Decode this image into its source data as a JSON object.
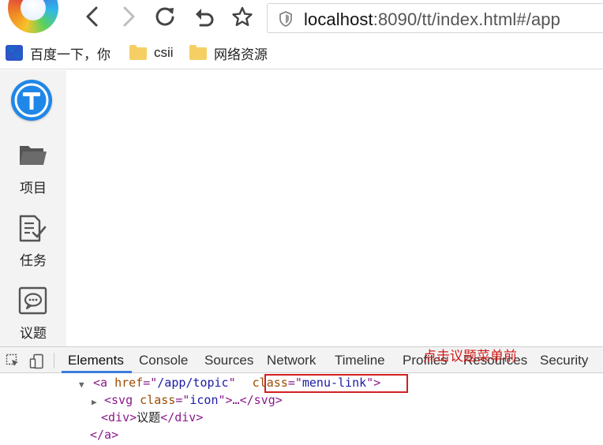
{
  "browser": {
    "url_host": "localhost",
    "url_rest": ":8090/tt/index.html#/app",
    "nav_icons": [
      "back-icon",
      "forward-icon",
      "reload-icon",
      "undo-icon",
      "star-icon"
    ]
  },
  "bookmarks": [
    {
      "label": "百度一下，你",
      "icon": "baidu-paw-icon"
    },
    {
      "label": "csii",
      "icon": "folder-icon"
    },
    {
      "label": "网络资源",
      "icon": "folder-icon"
    }
  ],
  "app": {
    "logo_letter": "T",
    "menu": [
      {
        "label": "项目",
        "icon": "folder-icon"
      },
      {
        "label": "任务",
        "icon": "task-icon"
      },
      {
        "label": "议题",
        "icon": "topic-icon"
      }
    ]
  },
  "devtools": {
    "tabs": [
      "Elements",
      "Console",
      "Sources",
      "Network",
      "Timeline",
      "Profiles",
      "Resources",
      "Security"
    ],
    "active_tab": "Elements",
    "annotation": "点击议题菜单前",
    "dom": {
      "line1": {
        "open": "<a ",
        "href_attr": "href",
        "eq": "=\"",
        "href_val": "/app/topic",
        "close_q": "\"",
        "class_attr": "class",
        "class_val": "menu-link",
        "end": ">"
      },
      "line2": {
        "open": "<svg ",
        "class_attr": "class",
        "class_val": "icon",
        "mid": ">…</svg>"
      },
      "line3": {
        "open": "<div>",
        "text": "议题",
        "close": "</div>"
      },
      "line4": {
        "close": "</a>"
      }
    },
    "colors": {
      "highlight": "#d32020",
      "annotation": "#d11a1a",
      "active_underline": "#3b7ddd"
    }
  }
}
